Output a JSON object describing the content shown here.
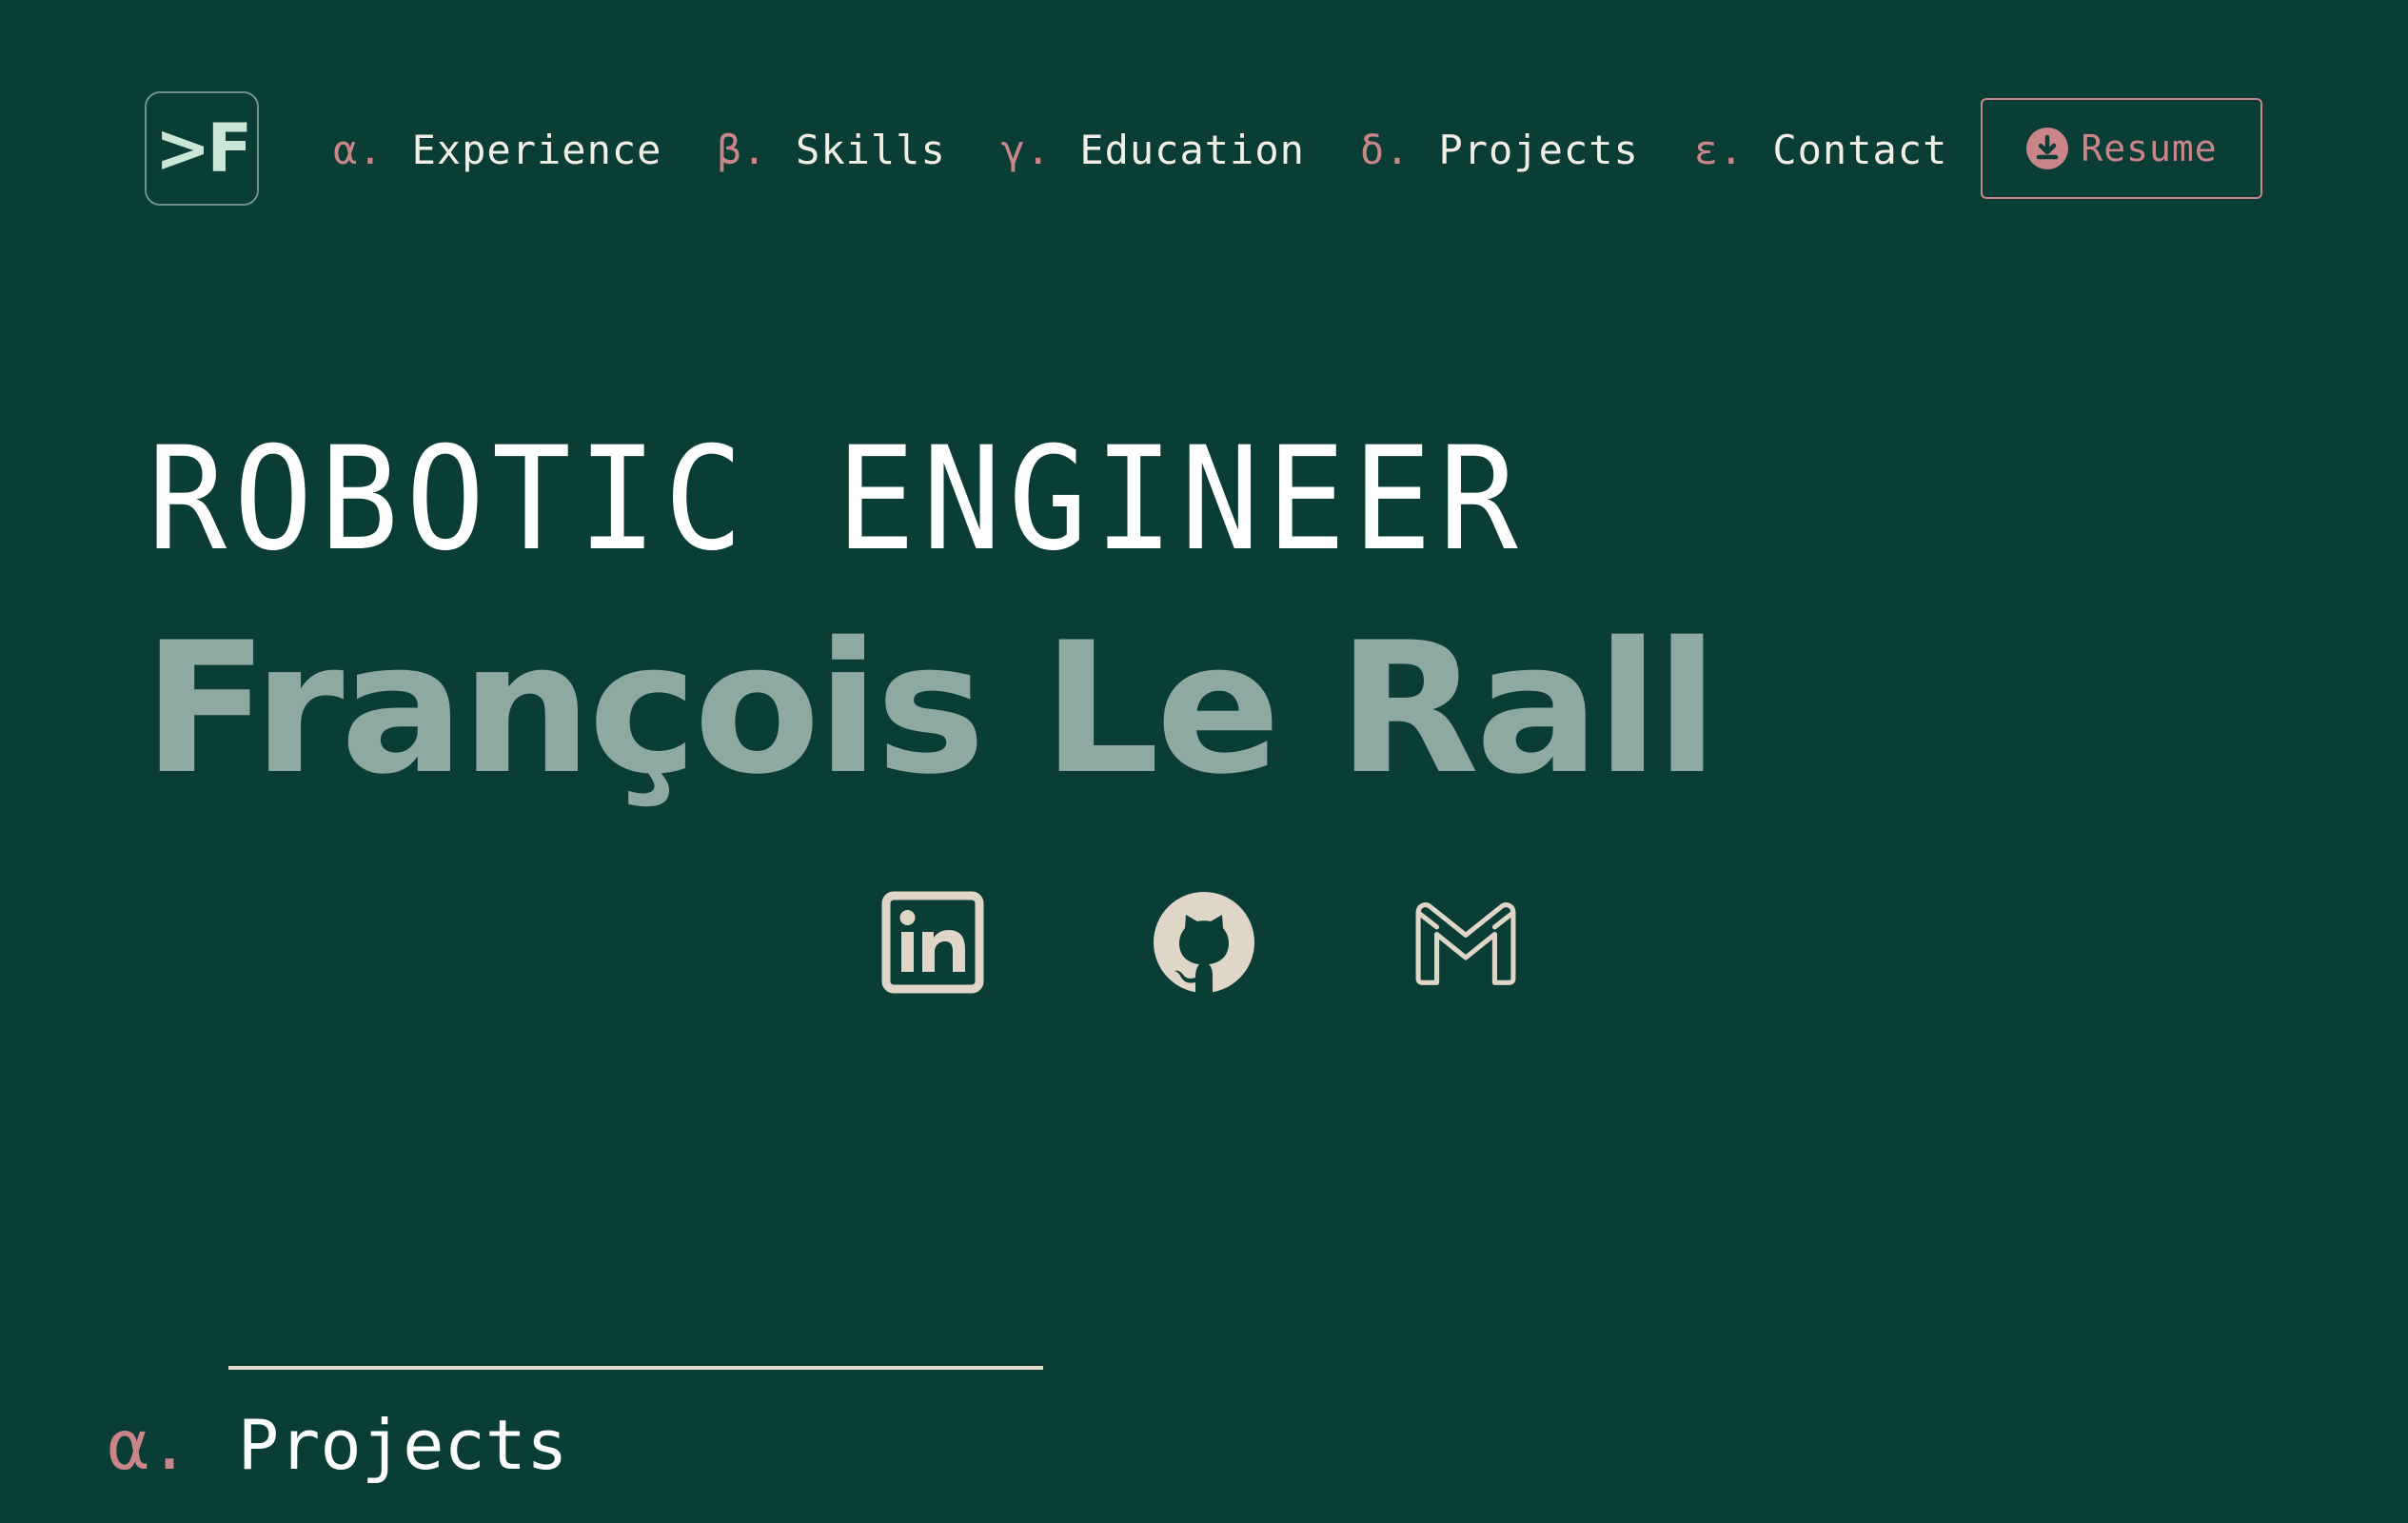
{
  "logo": {
    "text": ">F"
  },
  "nav": {
    "items": [
      {
        "index": "α.",
        "label": "Experience"
      },
      {
        "index": "β.",
        "label": "Skills"
      },
      {
        "index": "γ.",
        "label": "Education"
      },
      {
        "index": "δ.",
        "label": "Projects"
      },
      {
        "index": "ε.",
        "label": "Contact"
      }
    ],
    "resume": {
      "label": "Resume",
      "icon": "download-circle-icon"
    }
  },
  "hero": {
    "role": "ROBOTIC ENGINEER",
    "name": "François Le Rall"
  },
  "socials": [
    {
      "name": "linkedin",
      "icon": "linkedin-icon"
    },
    {
      "name": "github",
      "icon": "github-icon"
    },
    {
      "name": "gmail",
      "icon": "gmail-icon"
    }
  ],
  "section": {
    "index": "α.",
    "title": "Projects"
  },
  "colors": {
    "background": "#0a3d36",
    "accent": "#c98588",
    "name": "#8ea8a2",
    "icon": "#e0d6c8",
    "text": "#f4efe6"
  }
}
